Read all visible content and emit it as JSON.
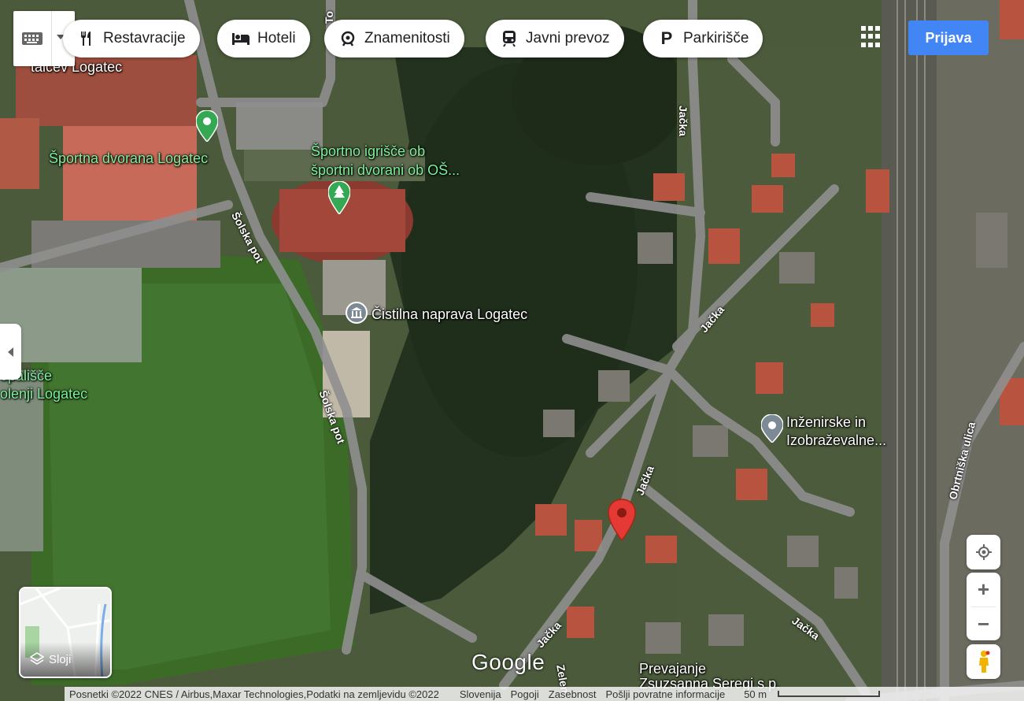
{
  "topbar": {
    "chips": [
      {
        "label": "Restavracije",
        "icon": "fork-knife-icon"
      },
      {
        "label": "Hoteli",
        "icon": "bed-icon"
      },
      {
        "label": "Znamenitosti",
        "icon": "camera-attraction-icon"
      },
      {
        "label": "Javni prevoz",
        "icon": "train-icon"
      },
      {
        "label": "Parkirišče",
        "icon": "parking-icon"
      }
    ],
    "apps_icon": "apps-grid-icon",
    "signin_label": "Prijava"
  },
  "map": {
    "type": "satellite",
    "places": [
      {
        "name": "talcev Logatec",
        "color": "#ffffff"
      },
      {
        "name": "Športna dvorana Logatec",
        "color": "#7ff09a",
        "icon": "map-pin-green-icon"
      },
      {
        "name": "Športno igrišče ob\nšportni dvorani ob OŠ...",
        "color": "#7ff09a",
        "icon": "park-tree-icon"
      },
      {
        "name": "Čistilna naprava Logatec",
        "color": "#ffffff",
        "icon": "museum-icon"
      },
      {
        "name": "opališče\nolenji Logatec",
        "color": "#7ff09a"
      },
      {
        "name": "Inženirske in\nIzobraževalne...",
        "color": "#ffffff",
        "icon": "map-pin-grey-icon"
      },
      {
        "name": "Prevajanje\nZsuzsanna Seregi s.p.",
        "color": "#ffffff"
      }
    ],
    "roads": [
      "Jačka",
      "Jačka",
      "Jačka",
      "Jačka",
      "Jačka",
      "Šolska pot",
      "Šolska pot",
      "Obrtniška ulica",
      "Zelen",
      "To"
    ],
    "selected_marker": "red-location-pin-icon"
  },
  "controls": {
    "layers_label": "Sloji",
    "zoom_in": "+",
    "zoom_out": "−",
    "my_location_icon": "my-location-icon",
    "pegman_icon": "street-view-pegman-icon"
  },
  "branding": {
    "logo": "Google"
  },
  "footer": {
    "attribution": "Posnetki ©2022 CNES / Airbus,Maxar Technologies,Podatki na zemljevidu ©2022",
    "country": "Slovenija",
    "terms": "Pogoji",
    "privacy": "Zasebnost",
    "feedback": "Pošlji povratne informacije",
    "scale": "50 m"
  }
}
